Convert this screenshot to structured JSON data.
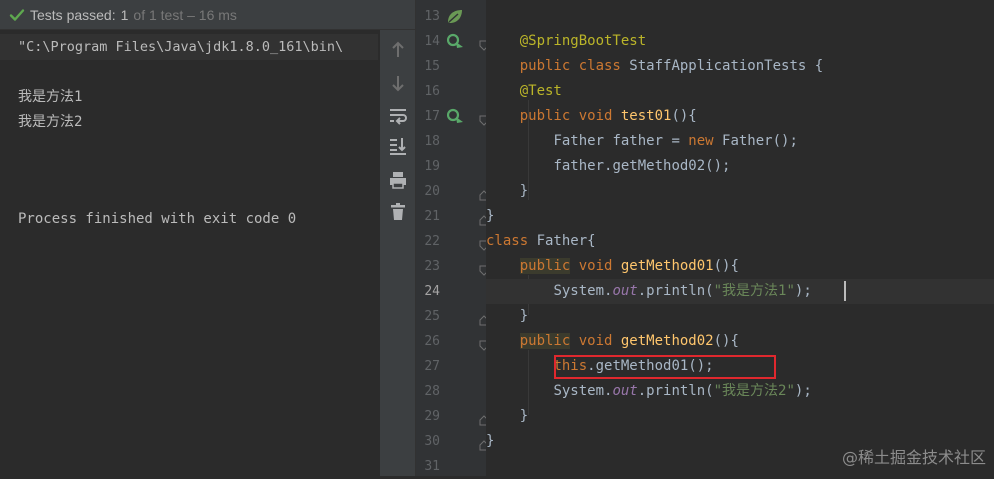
{
  "run_panel": {
    "status": {
      "passed_label": "Tests passed:",
      "count": "1",
      "detail": "of 1 test – 16 ms"
    },
    "console": {
      "command": "\"C:\\Program Files\\Java\\jdk1.8.0_161\\bin\\",
      "lines": [
        "我是方法1",
        "我是方法2",
        "Process finished with exit code 0"
      ]
    },
    "toolbar": [
      "up-arrow-icon",
      "down-arrow-icon",
      "soft-wrap-icon",
      "scroll-to-end-icon",
      "print-icon",
      "trash-icon"
    ]
  },
  "editor": {
    "line_numbers": [
      "13",
      "14",
      "15",
      "16",
      "17",
      "18",
      "19",
      "20",
      "21",
      "22",
      "23",
      "24",
      "25",
      "26",
      "27",
      "28",
      "29",
      "30",
      "31"
    ],
    "current_line": "24",
    "tokens": {
      "l13": {
        "a": "@SpringBootTest"
      },
      "l14": {
        "a": "public class ",
        "b": "StaffApplicationTests {"
      },
      "l16": {
        "a": "@Test"
      },
      "l17": {
        "a": "public void ",
        "b": "test01",
        "c": "(){"
      },
      "l18": {
        "a": "Father father = ",
        "b": "new ",
        "c": "Father();"
      },
      "l19": {
        "a": "father.getMethod02();"
      },
      "l20": {
        "a": "}"
      },
      "l21": {
        "a": "}"
      },
      "l22": {
        "a": "class ",
        "b": "Father{"
      },
      "l23": {
        "a": "public",
        "b": " void ",
        "c": "getMethod01",
        "d": "(){"
      },
      "l24": {
        "a": "System.",
        "b": "out",
        "c": ".println(",
        "d": "\"我是方法1\"",
        "e": ");"
      },
      "l25": {
        "a": "}"
      },
      "l26": {
        "a": "public",
        "b": " void ",
        "c": "getMethod02",
        "d": "(){"
      },
      "l27": {
        "a": "this",
        "b": ".getMethod01();"
      },
      "l28": {
        "a": "System.",
        "b": "out",
        "c": ".println(",
        "d": "\"我是方法2\"",
        "e": ");"
      },
      "l29": {
        "a": "}"
      },
      "l30": {
        "a": "}"
      }
    }
  },
  "watermark": "@稀土掘金技术社区"
}
